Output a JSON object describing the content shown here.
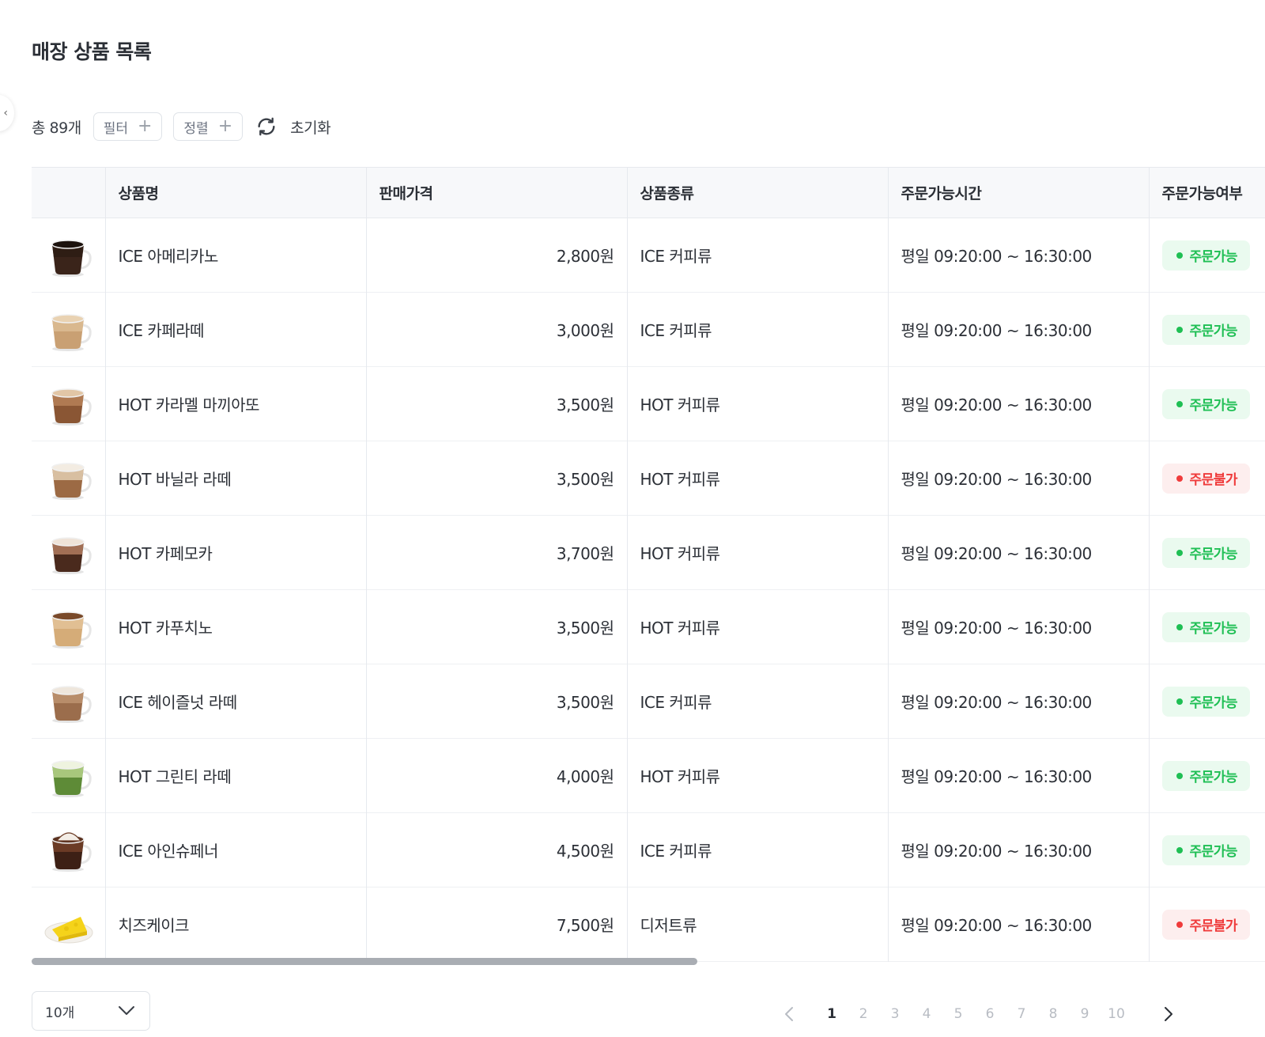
{
  "page": {
    "title": "매장 상품 목록"
  },
  "toolbar": {
    "total": "총 89개",
    "filter_label": "필터",
    "sort_label": "정렬",
    "reset_label": "초기화"
  },
  "table": {
    "headers": [
      "상품명",
      "판매가격",
      "상품종류",
      "주문가능시간",
      "주문가능여부"
    ],
    "rows": [
      {
        "image": "black-coffee-cup",
        "name": "ICE 아메리카노",
        "price": "2,800원",
        "type": "ICE 커피류",
        "time": "평일 09:20:00 ~ 16:30:00",
        "status": "주문가능",
        "available": true
      },
      {
        "image": "latte-cup",
        "name": "ICE 카페라떼",
        "price": "3,000원",
        "type": "ICE 커피류",
        "time": "평일 09:20:00 ~ 16:30:00",
        "status": "주문가능",
        "available": true
      },
      {
        "image": "caramel-cup",
        "name": "HOT 카라멜 마끼아또",
        "price": "3,500원",
        "type": "HOT 커피류",
        "time": "평일 09:20:00 ~ 16:30:00",
        "status": "주문가능",
        "available": true
      },
      {
        "image": "vanilla-latte-cup",
        "name": "HOT 바닐라 라떼",
        "price": "3,500원",
        "type": "HOT 커피류",
        "time": "평일 09:20:00 ~ 16:30:00",
        "status": "주문불가",
        "available": false
      },
      {
        "image": "mocha-cup",
        "name": "HOT 카페모카",
        "price": "3,700원",
        "type": "HOT 커피류",
        "time": "평일 09:20:00 ~ 16:30:00",
        "status": "주문가능",
        "available": true
      },
      {
        "image": "cappuccino-cup",
        "name": "HOT 카푸치노",
        "price": "3,500원",
        "type": "HOT 커피류",
        "time": "평일 09:20:00 ~ 16:30:00",
        "status": "주문가능",
        "available": true
      },
      {
        "image": "hazelnut-latte-cup",
        "name": "ICE 헤이즐넛 라떼",
        "price": "3,500원",
        "type": "ICE 커피류",
        "time": "평일 09:20:00 ~ 16:30:00",
        "status": "주문가능",
        "available": true
      },
      {
        "image": "green-tea-latte-cup",
        "name": "HOT 그린티 라떼",
        "price": "4,000원",
        "type": "HOT 커피류",
        "time": "평일 09:20:00 ~ 16:30:00",
        "status": "주문가능",
        "available": true
      },
      {
        "image": "einspanner-cup",
        "name": "ICE 아인슈페너",
        "price": "4,500원",
        "type": "ICE 커피류",
        "time": "평일 09:20:00 ~ 16:30:00",
        "status": "주문가능",
        "available": true
      },
      {
        "image": "cheesecake-plate",
        "name": "치즈케이크",
        "price": "7,500원",
        "type": "디저트류",
        "time": "평일 09:20:00 ~ 16:30:00",
        "status": "주문불가",
        "available": false
      }
    ]
  },
  "pagination": {
    "page_size": "10개",
    "pages": [
      "1",
      "2",
      "3",
      "4",
      "5",
      "6",
      "7",
      "8",
      "9",
      "10"
    ],
    "current": "1"
  },
  "colors": {
    "available": "#1fbf54",
    "unavailable": "#ef3b3b"
  },
  "icons": [
    "collapse-chevron-icon",
    "plus-icon",
    "refresh-icon",
    "chevron-down-icon",
    "chevron-left-icon",
    "chevron-right-icon"
  ]
}
